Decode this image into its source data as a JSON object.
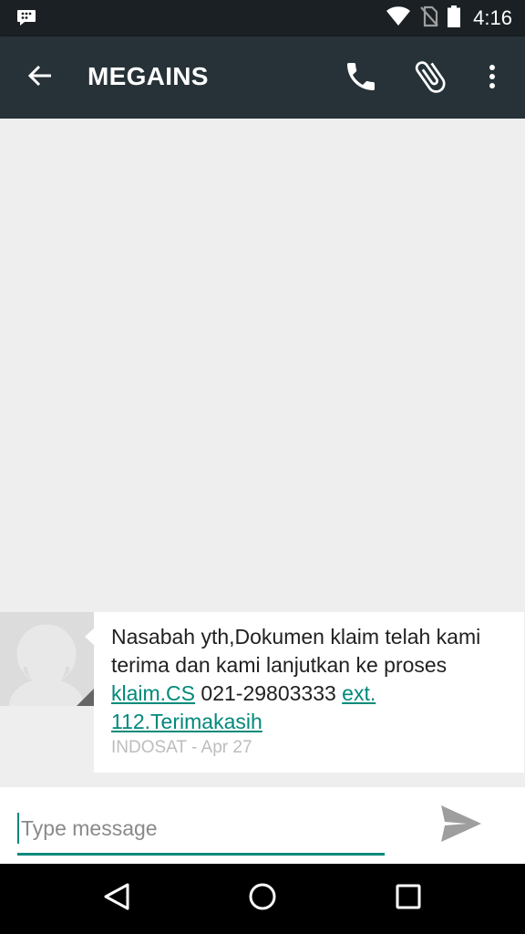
{
  "status_bar": {
    "time": "4:16",
    "icons": [
      "blackberry-messenger-icon",
      "wifi-icon",
      "no-sim-icon",
      "battery-icon"
    ]
  },
  "app_bar": {
    "title": "MEGAINS",
    "icons": [
      "back-arrow-icon",
      "phone-icon",
      "paperclip-icon",
      "more-vert-icon"
    ]
  },
  "message": {
    "text_part1": "Nasabah yth,Dokumen klaim telah kami terima dan kami lanjutkan ke proses ",
    "link1": "klaim.CS",
    "text_part2": " 021-29803333 ",
    "link2": "ext. 112.Terimakasih",
    "meta": "INDOSAT - Apr 27"
  },
  "compose": {
    "placeholder": "Type message",
    "value": ""
  },
  "nav_bar": {
    "icons": [
      "nav-back-icon",
      "nav-home-icon",
      "nav-recents-icon"
    ]
  },
  "colors": {
    "app_bar": "#263238",
    "status_bar": "#1a2024",
    "accent": "#00897b",
    "background": "#eeeeee"
  }
}
